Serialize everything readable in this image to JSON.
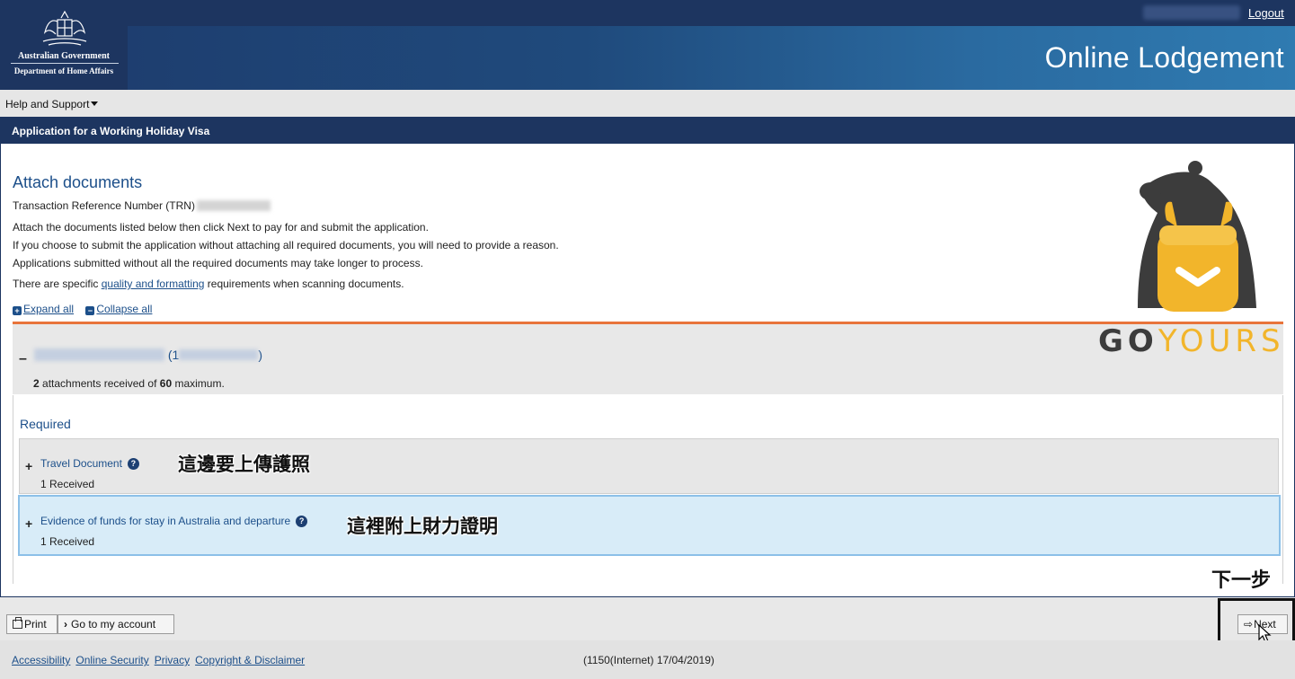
{
  "header": {
    "gov_line1": "Australian Government",
    "gov_line2": "Department of Home Affairs",
    "logout": "Logout",
    "app_title": "Online Lodgement"
  },
  "help": {
    "label": "Help and Support"
  },
  "application": {
    "title": "Application for a Working Holiday Visa"
  },
  "main": {
    "heading": "Attach documents",
    "trn_label": "Transaction Reference Number (TRN)",
    "para1": "Attach the documents listed below then click Next to pay for and submit the application.",
    "para2": "If you choose to submit the application without attaching all required documents, you will need to provide a reason.",
    "para3": "Applications submitted without all the required documents may take longer to process.",
    "para4_before": "There are specific ",
    "para4_link": "quality and formatting",
    "para4_after": " requirements when scanning documents.",
    "expand_all": "Expand all",
    "collapse_all": "Collapse all"
  },
  "applicant": {
    "name_prefix": "(1",
    "name_suffix": ")",
    "attachments_count": "2",
    "attachments_mid": " attachments received of ",
    "attachments_max": "60",
    "attachments_end": " maximum."
  },
  "required": {
    "label": "Required",
    "documents": [
      {
        "title": "Travel Document",
        "status": "1 Received",
        "annotation": "這邊要上傳護照"
      },
      {
        "title": "Evidence of funds for stay in Australia and departure",
        "status": "1 Received",
        "annotation": "這裡附上財力證明"
      }
    ]
  },
  "watermark": {
    "go": "GO",
    "yours": "YOURS"
  },
  "buttons": {
    "print": "Print",
    "account": "Go to my account",
    "next": "Next",
    "next_annotation": "下一步"
  },
  "footer": {
    "links": [
      "Accessibility",
      "Online Security",
      "Privacy",
      "Copyright & Disclaimer"
    ],
    "version": "(1150(Internet) 17/04/2019)"
  },
  "colors": {
    "navy": "#1d3560",
    "link": "#1c4f8a",
    "accent_orange": "#e8743b",
    "brand_yellow": "#f2b52b"
  }
}
